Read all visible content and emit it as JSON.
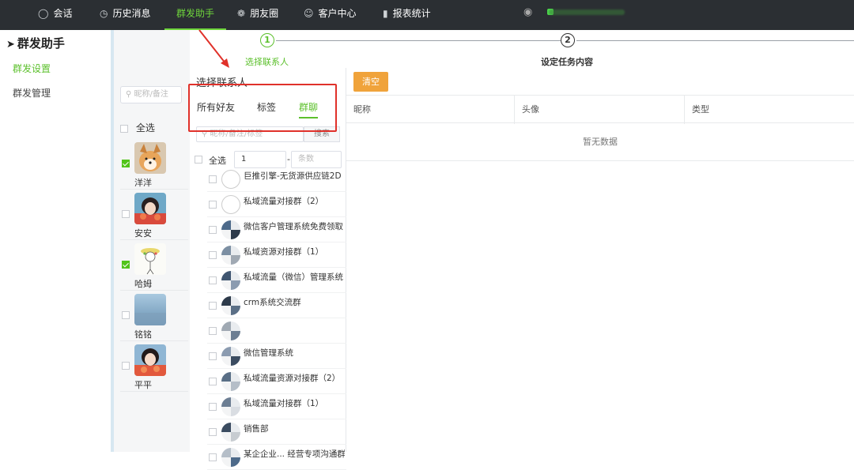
{
  "nav": {
    "items": [
      {
        "label": "会话",
        "icon": "chat-icon"
      },
      {
        "label": "历史消息",
        "icon": "clock-icon"
      },
      {
        "label": "群发助手",
        "icon": ""
      },
      {
        "label": "朋友圈",
        "icon": "aperture-icon"
      },
      {
        "label": "客户中心",
        "icon": "user-icon"
      },
      {
        "label": "报表统计",
        "icon": "bar-chart-icon"
      }
    ],
    "active_index": 2
  },
  "sidebar": {
    "title": "群发助手",
    "items": [
      {
        "label": "群发设置",
        "active": true
      },
      {
        "label": "群发管理",
        "active": false
      }
    ]
  },
  "steps": [
    {
      "num": "1",
      "label": "选择联系人",
      "active": true
    },
    {
      "num": "2",
      "label": "设定任务内容",
      "active": false
    }
  ],
  "accounts": {
    "search_placeholder": "昵称/备注",
    "select_all": "全选",
    "list": [
      {
        "name": "洋洋",
        "checked": true,
        "avatar": "dog"
      },
      {
        "name": "安安",
        "checked": false,
        "avatar": "girl"
      },
      {
        "name": "哈姆",
        "checked": true,
        "avatar": "sketch"
      },
      {
        "name": "铭铭",
        "checked": false,
        "avatar": "sky"
      },
      {
        "name": "平平",
        "checked": false,
        "avatar": "girl2"
      }
    ]
  },
  "contacts": {
    "title": "选择联系人",
    "tabs": [
      "所有好友",
      "标签",
      "群聊"
    ],
    "active_tab": 2,
    "search_placeholder": "昵称/备注/标签",
    "search_button": "搜索",
    "select_all": "全选",
    "range_from": "1",
    "range_sep": "-",
    "range_to_placeholder": "条数",
    "groups": [
      "巨推引擎-无货源供应链2D",
      "私域流量对接群（2）",
      "微信客户管理系统免费领取",
      "私域资源对接群（1）",
      "私域流量（微信）管理系统",
      "crm系统交流群",
      "",
      "微信管理系统",
      "私域流量资源对接群（2）",
      "私域流量对接群（1）",
      "销售部",
      "某企企业... 经营专项沟通群"
    ]
  },
  "content": {
    "clear_button": "清空",
    "columns": [
      "昵称",
      "头像",
      "类型"
    ],
    "empty_text": "暂无数据"
  },
  "colors": {
    "accent": "#5cc02c",
    "topbar": "#2b2f33",
    "clear_btn": "#f0a33b",
    "annotation": "#e0312a"
  }
}
